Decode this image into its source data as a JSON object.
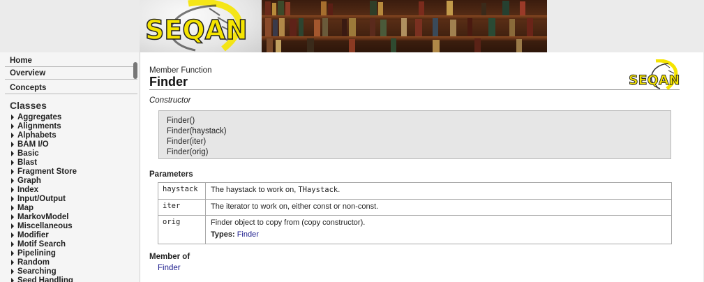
{
  "banner": {
    "logo_text": "SEQAN"
  },
  "sidebar": {
    "links": [
      "Home",
      "Overview",
      "Concepts"
    ],
    "classes_heading": "Classes",
    "classes": [
      "Aggregates",
      "Alignments",
      "Alphabets",
      "BAM I/O",
      "Basic",
      "Blast",
      "Fragment Store",
      "Graph",
      "Index",
      "Input/Output",
      "Map",
      "MarkovModel",
      "Miscellaneous",
      "Modifier",
      "Motif Search",
      "Pipelining",
      "Random",
      "Searching",
      "Seed Handling"
    ]
  },
  "main": {
    "kind": "Member Function",
    "title": "Finder",
    "logo_text": "SEQAN",
    "constructor_label": "Constructor",
    "signatures": [
      "Finder()",
      "Finder(haystack)",
      "Finder(iter)",
      "Finder(orig)"
    ],
    "params_heading": "Parameters",
    "params": [
      {
        "name": "haystack",
        "desc": "The haystack to work on, ",
        "code": "THaystack",
        "suffix": "."
      },
      {
        "name": "iter",
        "desc": "The iterator to work on, either const or non-const."
      },
      {
        "name": "orig",
        "desc": "Finder object to copy from (copy constructor).",
        "types_label": "Types:",
        "types_value": "Finder"
      }
    ],
    "memberof_heading": "Member of",
    "memberof_link": "Finder"
  },
  "colors": {
    "accent_yellow": "#f5e400",
    "link": "#1a1a8c",
    "sidebar_bg": "#f5f5f5",
    "signature_bg": "#e6e6e6"
  }
}
